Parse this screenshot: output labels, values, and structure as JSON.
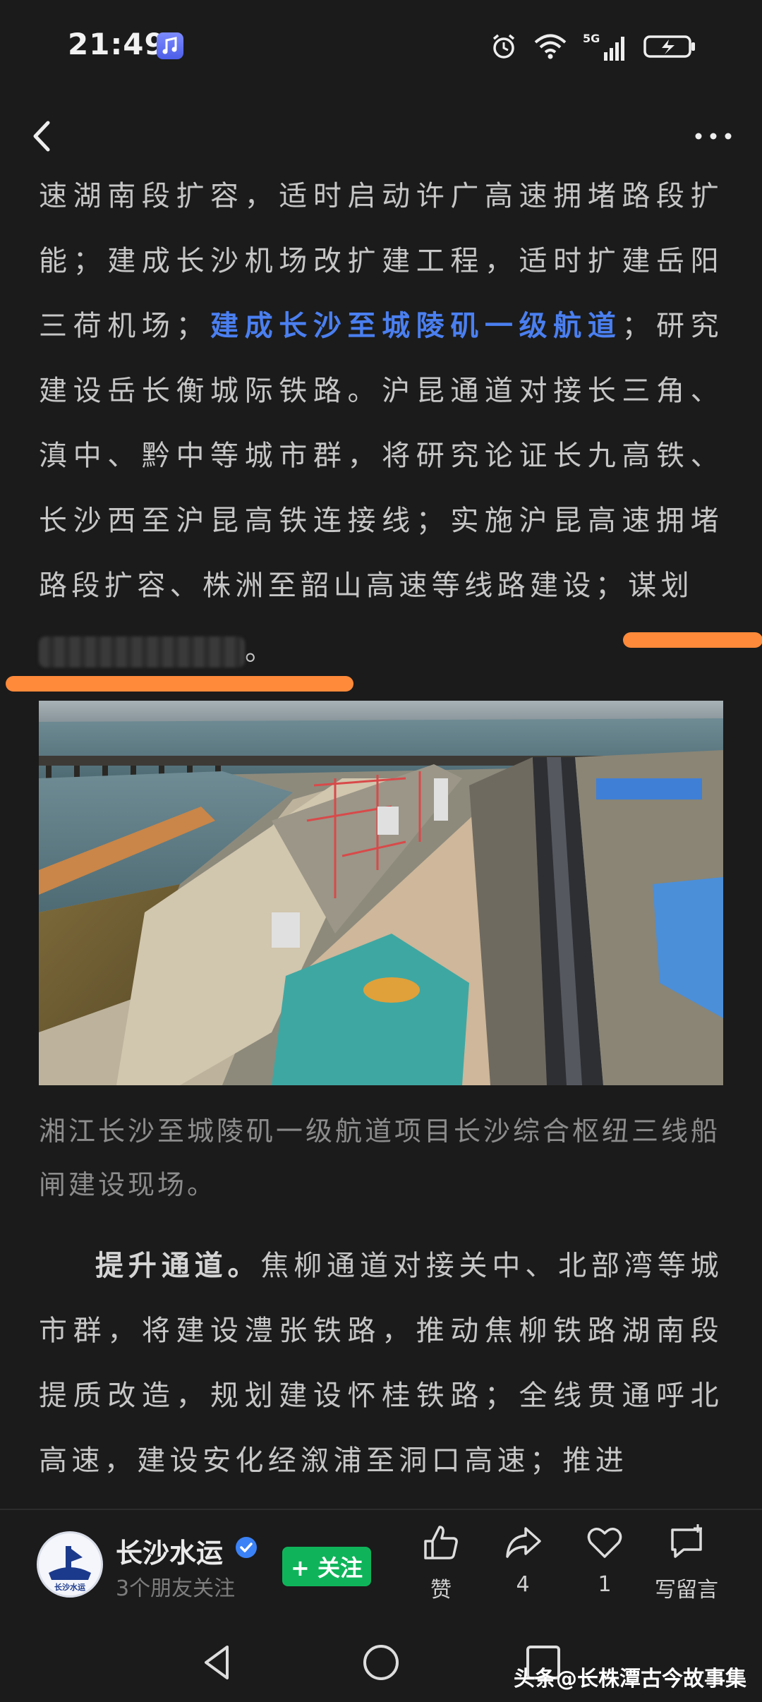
{
  "status": {
    "time": "21:49",
    "network": "5G"
  },
  "nav": {
    "back_icon": "chevron-left-icon",
    "more_icon": "more-dots-icon"
  },
  "article": {
    "para1_before_highlight": "速湖南段扩容，适时启动许广高速拥堵路段扩能；建成长沙机场改扩建工程，适时扩建岳阳三荷机场；",
    "para1_highlight": "建成长沙至城陵矶一级航道",
    "para1_after_highlight": "；研究建设岳长衡城际铁路。沪昆通道对接长三角、滇中、黔中等城市群，将研究论证长九高铁、长沙西至沪昆高铁连接线；实施沪昆高速拥堵路段扩容、株洲至韶山高速等线路建设；谋划",
    "para1_end": "。",
    "caption": "湘江长沙至城陵矶一级航道项目长沙综合枢纽三线船闸建设现场。",
    "para2_bold": "提升通道。",
    "para2_text": "焦柳通道对接关中、北部湾等城市群，将建设澧张铁路，推动焦柳铁路湖南段提质改造，规划建设怀桂铁路；全线贯通呼北高速，建设安化经溆浦至洞口高速；推进"
  },
  "colors": {
    "highlight": "#4a7ff0",
    "marker": "#ff8a3a",
    "follow": "#0fb45a"
  },
  "bottom_bar": {
    "author": "长沙水运",
    "friends": "3个朋友关注",
    "follow_label": "+ 关注",
    "like_label": "赞",
    "share_count": "4",
    "favorite_count": "1",
    "comment_label": "写留言"
  },
  "watermark": {
    "source": "头条",
    "handle": "@长株潭古今故事集"
  }
}
